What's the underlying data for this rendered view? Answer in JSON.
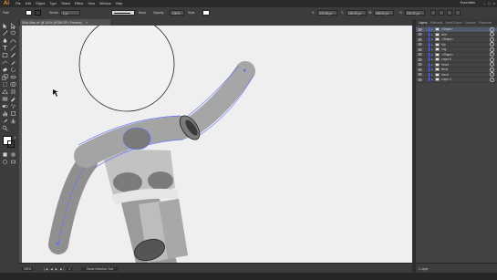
{
  "app": {
    "logo": "Ai"
  },
  "menu": [
    "File",
    "Edit",
    "Object",
    "Type",
    "Select",
    "Effect",
    "View",
    "Window",
    "Help"
  ],
  "workspace": "Essentials",
  "window_controls": [
    "–",
    "□",
    "×"
  ],
  "control_bar": {
    "selection_label": "Path",
    "stroke_label": "Stroke",
    "stroke_value": "1 pt",
    "style_label": "Basic",
    "opacity_label": "Opacity",
    "opacity_value": "100%",
    "style2_label": "Style",
    "x_label": "X:",
    "x_value": "473.08 px",
    "y_label": "Y:",
    "y_value": "184.02 px",
    "w_label": "W:",
    "w_value": "269.02 px",
    "h_label": "H:",
    "h_value": "230.21 px"
  },
  "document_tab": {
    "title": "Stick-Man.ai* @ 200% (RGB/GPU Preview)",
    "close": "×"
  },
  "layers_panel": {
    "tabs": [
      "Layers",
      "Artboards",
      "Asset Export",
      "Libraries",
      "Properties"
    ],
    "active_tab": "Layers",
    "rows": [
      {
        "name": "<Shape>",
        "has_chevron": true
      },
      {
        "name": "Arm",
        "has_chevron": true
      },
      {
        "name": "<Shape>",
        "has_chevron": true
      },
      {
        "name": "Hip",
        "has_chevron": true
      },
      {
        "name": "Leg",
        "has_chevron": true
      },
      {
        "name": "<Shape>",
        "has_chevron": true
      },
      {
        "name": "Layer 6",
        "has_chevron": true
      },
      {
        "name": "Head",
        "has_chevron": true
      },
      {
        "name": "Neck",
        "has_chevron": true
      },
      {
        "name": "Hand",
        "has_chevron": true
      },
      {
        "name": "Layer 4",
        "has_chevron": true
      }
    ],
    "footer": "1 Layer",
    "accent_color": "#5b6fff"
  },
  "status_bar": {
    "zoom": "200%",
    "page": "1",
    "nav_arrows": "|◀ ◀ ▶ ▶|",
    "status": "Direct Selection Tool"
  },
  "colors": {
    "selection": "#5b6fff",
    "artboard": "#efefef",
    "shape_fill": "#a4a4a4",
    "shape_dark": "#6f6f6f"
  }
}
